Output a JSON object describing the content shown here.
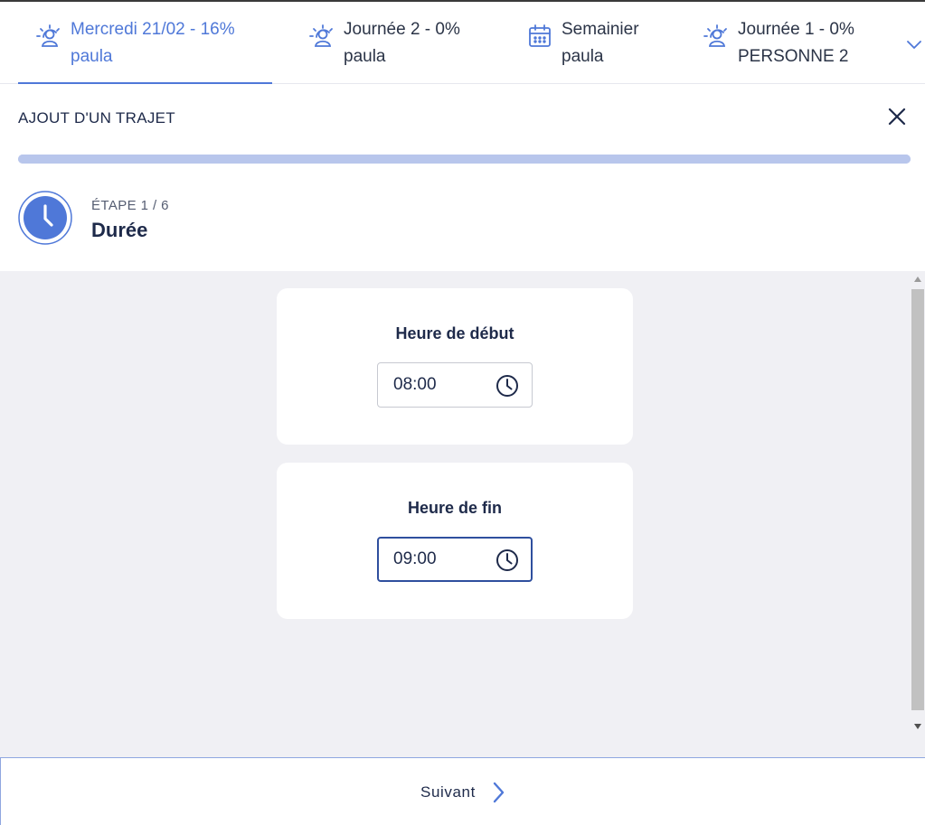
{
  "tabs": [
    {
      "line1": "Mercredi 21/02 - 16%",
      "line2": "paula",
      "icon": "sunrise-person-icon",
      "active": true
    },
    {
      "line1": "Journée 2 - 0%",
      "line2": "paula",
      "icon": "sunrise-person-icon",
      "active": false
    },
    {
      "line1": "Semainier",
      "line2": "paula",
      "icon": "calendar-icon",
      "active": false
    },
    {
      "line1": "Journée 1 - 0%",
      "line2": "PERSONNE 2",
      "icon": "sunrise-person-icon",
      "active": false
    }
  ],
  "header": {
    "title": "AJOUT D'UN TRAJET"
  },
  "progress": {
    "fraction": 1.0
  },
  "step": {
    "label": "ÉTAPE 1 / 6",
    "title": "Durée",
    "icon": "clock-icon"
  },
  "form": {
    "start": {
      "label": "Heure de début",
      "value": "08:00"
    },
    "end": {
      "label": "Heure de fin",
      "value": "09:00"
    }
  },
  "footer": {
    "next_label": "Suivant"
  },
  "colors": {
    "accent": "#4f78d8",
    "text": "#1e2a4a",
    "progress": "#b8c6ec",
    "background": "#f0f0f4"
  }
}
